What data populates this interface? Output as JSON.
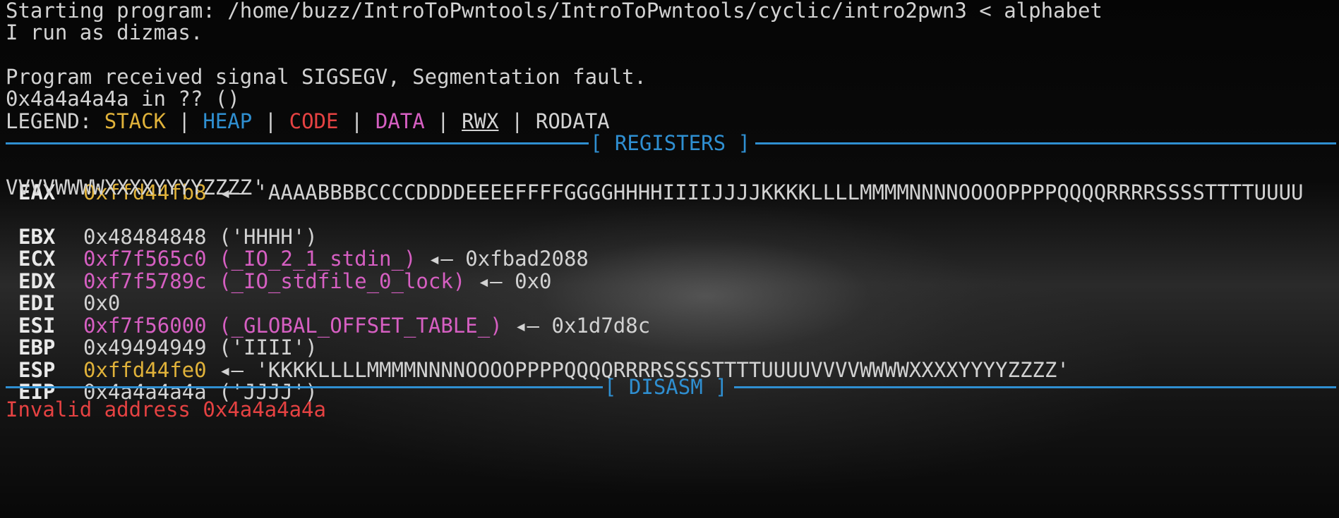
{
  "colors": {
    "stack": "#e0b23a",
    "heap": "#2f8fd1",
    "code": "#e54242",
    "data": "#d65fc2",
    "text": "#d2d2d2",
    "separator": "#2f8fd1"
  },
  "terminal": {
    "line1": "Starting program: /home/buzz/IntroToPwntools/IntroToPwntools/cyclic/intro2pwn3 < alphabet",
    "line2": "I run as dizmas.",
    "line3": "",
    "line4": "Program received signal SIGSEGV, Segmentation fault.",
    "line5": "0x4a4a4a4a in ?? ()",
    "legend": {
      "prefix": "LEGEND: ",
      "stack": "STACK",
      "heap": "HEAP",
      "code": "CODE",
      "data": "DATA",
      "rwx": "RWX",
      "rodata": "RODATA",
      "sep": " | "
    },
    "registers_header": "[ REGISTERS ]",
    "disasm_header": "[ DISASM ]",
    "registers": {
      "eax": {
        "name": "EAX",
        "addr": "0xffd44fb8",
        "arrow": " ◂— ",
        "value": "'AAAABBBBCCCCDDDDEEEEFFFFGGGGHHHHIIIIJJJJKKKKLLLLMMMMNNNNOOOOPPPPQQQQRRRRSSSSTTTTUUUU",
        "value_cont": "VVVVWWWWXXXXYYYYZZZZ'"
      },
      "ebx": {
        "name": "EBX",
        "addr": "0x48484848",
        "rest": " ('HHHH')"
      },
      "ecx": {
        "name": "ECX",
        "addr": "0xf7f565c0",
        "sym": " (_IO_2_1_stdin_)",
        "arrow": " ◂— ",
        "value": "0xfbad2088"
      },
      "edx": {
        "name": "EDX",
        "addr": "0xf7f5789c",
        "sym": " (_IO_stdfile_0_lock)",
        "arrow": " ◂— ",
        "value": "0x0"
      },
      "edi": {
        "name": "EDI",
        "addr": "0x0"
      },
      "esi": {
        "name": "ESI",
        "addr": "0xf7f56000",
        "sym": " (_GLOBAL_OFFSET_TABLE_)",
        "arrow": " ◂— ",
        "value": "0x1d7d8c"
      },
      "ebp": {
        "name": "EBP",
        "addr": "0x49494949",
        "rest": " ('IIII')"
      },
      "esp": {
        "name": "ESP",
        "addr": "0xffd44fe0",
        "arrow": " ◂— ",
        "value": "'KKKKLLLLMMMMNNNNOOOOPPPPQQQQRRRRSSSSTTTTUUUUVVVVWWWWXXXXYYYYZZZZ'"
      },
      "eip": {
        "name": "EIP",
        "addr": "0x4a4a4a4a",
        "rest": " ('JJJJ')"
      }
    },
    "disasm_error": "Invalid address 0x4a4a4a4a"
  }
}
